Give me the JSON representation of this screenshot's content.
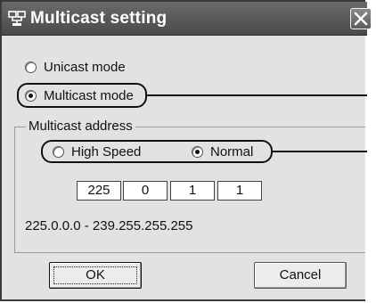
{
  "window": {
    "title": "Multicast setting"
  },
  "mode": {
    "unicast_label": "Unicast mode",
    "multicast_label": "Multicast mode",
    "selected": "multicast"
  },
  "address_group": {
    "title": "Multicast address",
    "speed": {
      "high_label": "High Speed",
      "normal_label": "Normal",
      "selected": "normal"
    },
    "octets": [
      "225",
      "0",
      "1",
      "1"
    ],
    "range_text": "225.0.0.0 - 239.255.255.255"
  },
  "buttons": {
    "ok_label": "OK",
    "cancel_label": "Cancel"
  }
}
